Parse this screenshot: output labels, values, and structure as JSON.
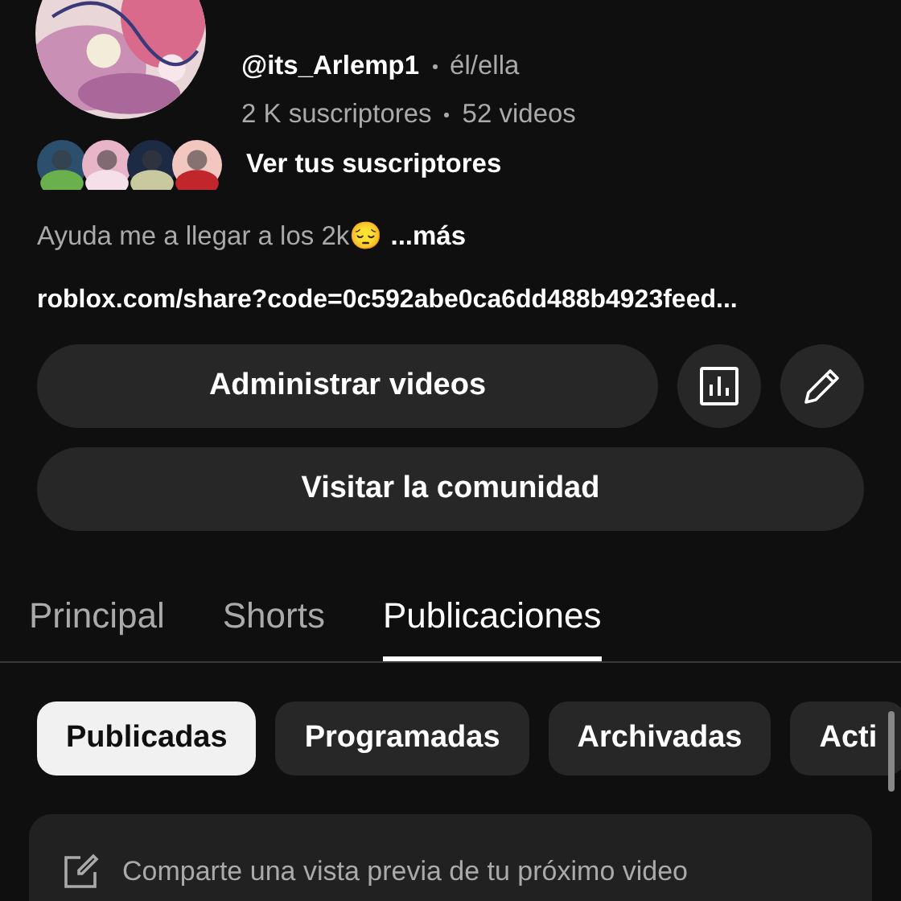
{
  "channel": {
    "handle": "@its_Arlemp1",
    "pronouns": "él/ella",
    "subscribers": "2 K suscriptores",
    "videos": "52 videos"
  },
  "subscribers_link": {
    "label": "Ver tus suscriptores"
  },
  "description": {
    "text": "Ayuda me a llegar a los 2k😔",
    "more": "...más"
  },
  "link": "roblox.com/share?code=0c592abe0ca6dd488b4923feed...",
  "buttons": {
    "manage": "Administrar videos",
    "community": "Visitar la comunidad"
  },
  "tabs": [
    {
      "label": "Principal",
      "selected": false
    },
    {
      "label": "Shorts",
      "selected": false
    },
    {
      "label": "Publicaciones",
      "selected": true
    }
  ],
  "chips": [
    {
      "label": "Publicadas",
      "selected": true
    },
    {
      "label": "Programadas",
      "selected": false
    },
    {
      "label": "Archivadas",
      "selected": false
    },
    {
      "label": "Acti",
      "selected": false
    }
  ],
  "composer": {
    "placeholder": "Comparte una vista previa de tu próximo video"
  }
}
